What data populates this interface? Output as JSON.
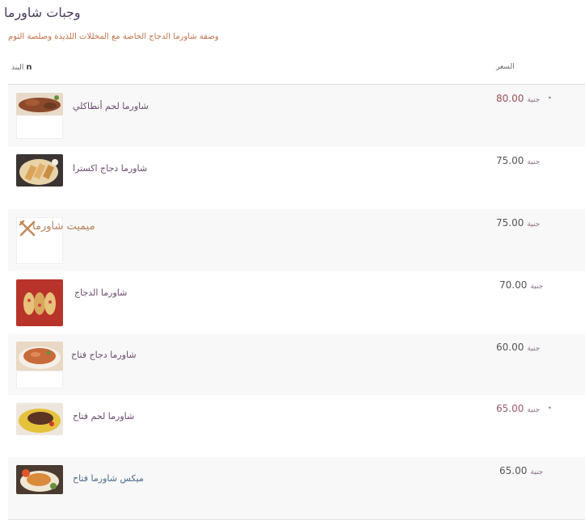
{
  "page": {
    "title": "وجبات شاورما",
    "subtitle": "وصفة شاورما الدجاج الخاصة مع المخللات اللذيذة وصلصة الثوم"
  },
  "table": {
    "headers": {
      "item": "البند",
      "item_marker": "n",
      "price": "السعر"
    },
    "rows": [
      {
        "name": "شاورما لحم أنطاكلي",
        "price": "80.00",
        "currency": "جنية",
        "image_icon": "meat-shawarma-plate"
      },
      {
        "name": "شاورما دجاج اكسترا",
        "price": "75.00",
        "currency": "جنية",
        "image_icon": "chicken-wraps-board"
      },
      {
        "name": "ميميت شاورما",
        "price": "75.00",
        "currency": "جنية",
        "image_icon": "fork-knife-icon"
      },
      {
        "name": "شاورما الدجاج",
        "price": "70.00",
        "currency": "جنية",
        "image_icon": "chicken-shawarma-tray"
      },
      {
        "name": "شاورما دجاج فتاح",
        "price": "60.00",
        "currency": "جنية",
        "image_icon": "chicken-fattah-plate"
      },
      {
        "name": "شاورما لحم فتاح",
        "price": "65.00",
        "currency": "جنية",
        "image_icon": "meat-fattah-plate"
      },
      {
        "name": "ميكس شاورما فتاح",
        "price": "65.00",
        "currency": "جنية",
        "image_icon": "mix-fattah-plate"
      }
    ]
  },
  "colors": {
    "accent": "#6b4a6e",
    "row_alt": "#f8f8f8",
    "border": "#e3e3e3",
    "subtitle": "#c0714a"
  }
}
